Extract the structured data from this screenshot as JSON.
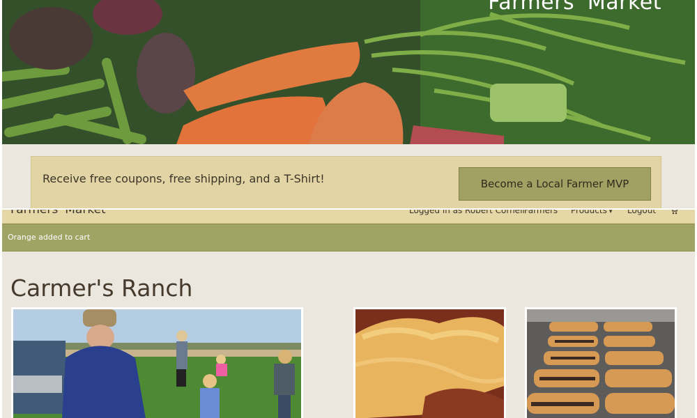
{
  "hero": {
    "title": "Farmers' Market",
    "image": "vegetable-harvest-photo"
  },
  "promo": {
    "text": "Receive free coupons, free shipping, and a T-Shirt!",
    "button_label": "Become a Local Farmer MVP"
  },
  "navbar": {
    "brand": "Farmers' Market",
    "items": {
      "user": "Logged in as Robert Cornell",
      "farmers": "Farmers",
      "products": "Products",
      "logout": "Logout"
    },
    "products_caret": "▾",
    "cart_icon": "cart-icon"
  },
  "flash": {
    "message": "Orange added to cart"
  },
  "farm": {
    "title": "Carmer's Ranch",
    "photos": [
      "farm-family-field-photo",
      "pie-photo",
      "pastry-tray-photo"
    ]
  },
  "colors": {
    "promo_background": "#e2d4a5",
    "button": "#a0a163",
    "flash": "#9fa465",
    "page_background": "#ebe7de"
  }
}
